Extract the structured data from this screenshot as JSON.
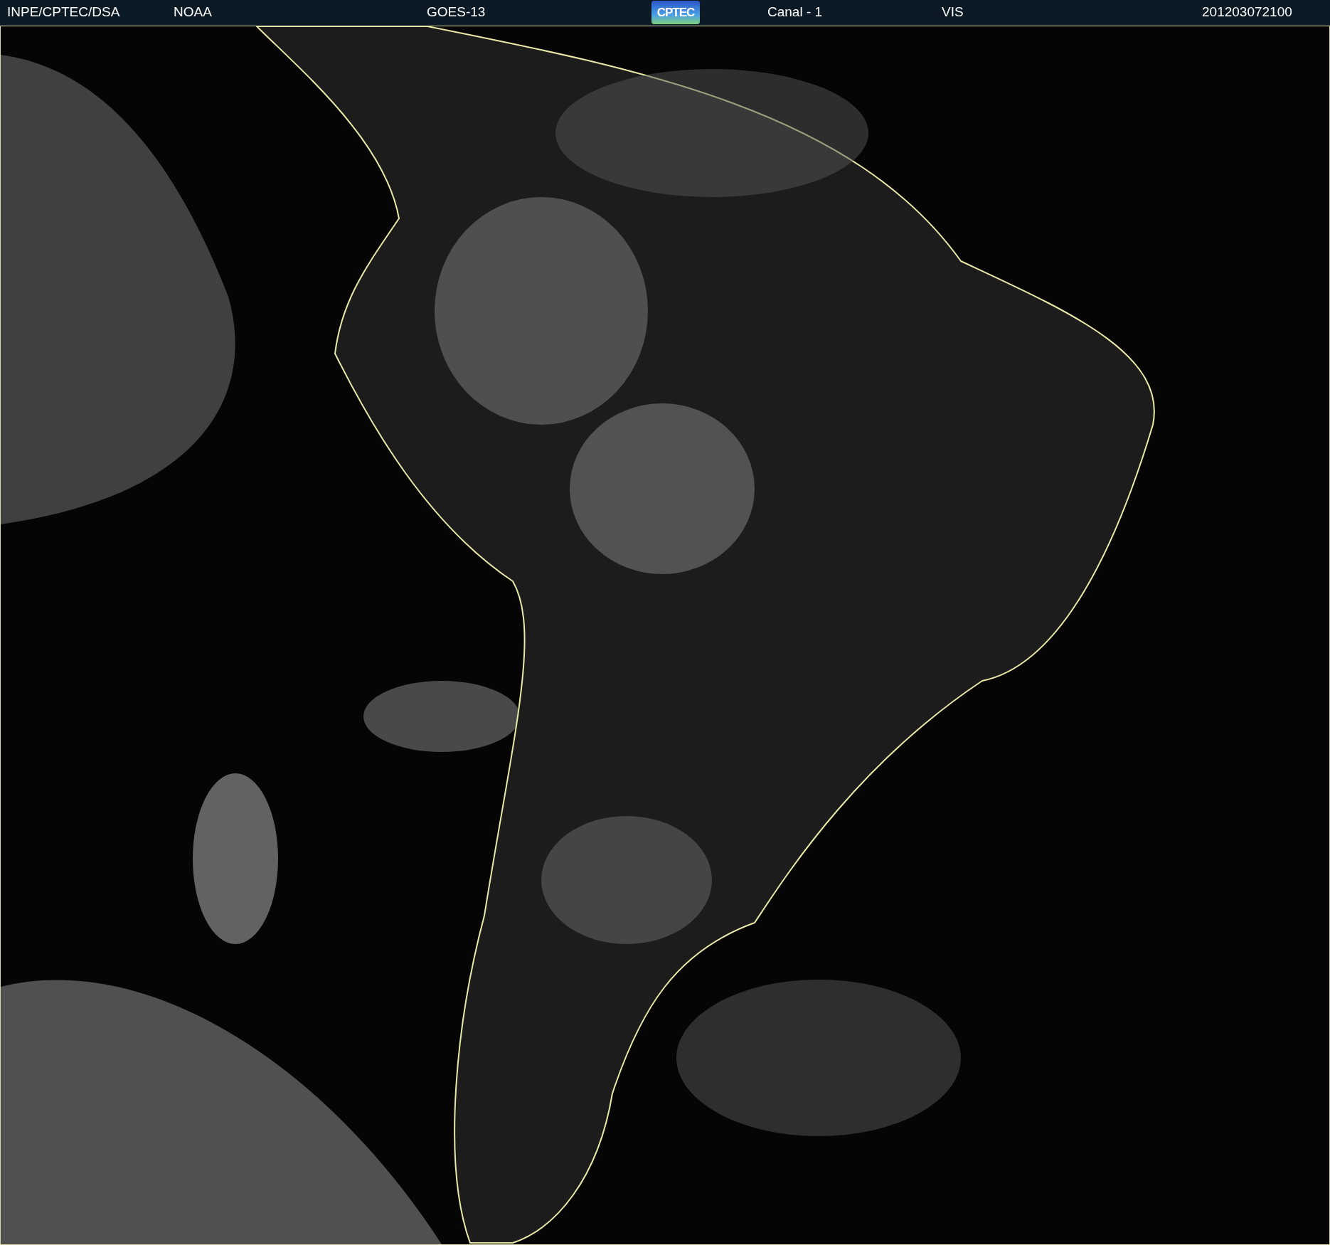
{
  "header": {
    "items": [
      {
        "kind": "text",
        "text": "INPE/CPTEC/DSA"
      },
      {
        "kind": "text",
        "text": "NOAA"
      },
      {
        "kind": "text",
        "text": "GOES-13"
      },
      {
        "kind": "logo",
        "text": "CPTEC"
      },
      {
        "kind": "text",
        "text": "Canal - 1"
      },
      {
        "kind": "text",
        "text": "VIS"
      },
      {
        "kind": "text",
        "text": "201203072100"
      }
    ]
  }
}
